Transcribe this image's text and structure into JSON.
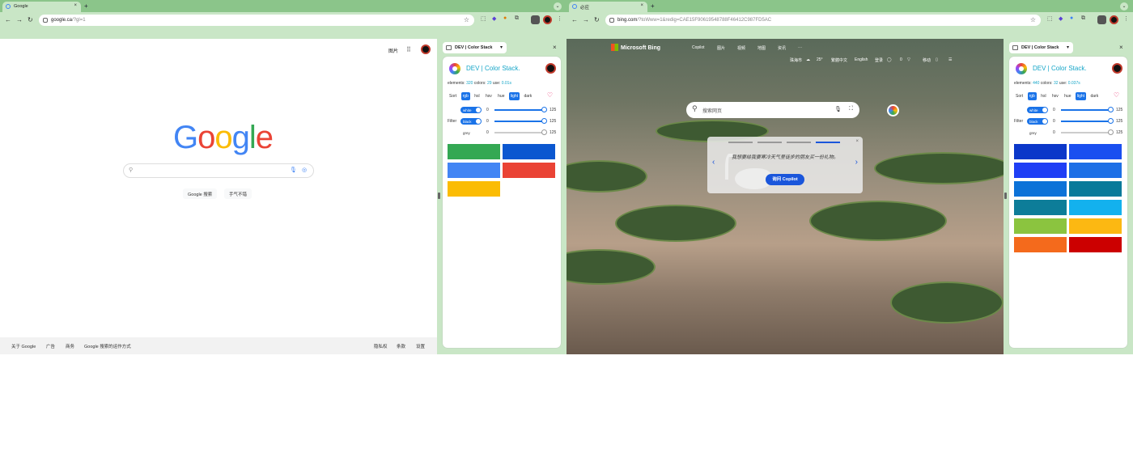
{
  "left": {
    "tab_title": "Google",
    "url_host": "google.ca",
    "url_path": "/?gl=1",
    "google": {
      "logo_g1": "G",
      "logo_o1": "o",
      "logo_o2": "o",
      "logo_g2": "g",
      "logo_l": "l",
      "logo_e": "e",
      "top_images": "图片",
      "search_button": "Google 搜索",
      "lucky_button": "手气不错",
      "footer": {
        "about": "关于 Google",
        "ads": "广告",
        "business": "商务",
        "how_search": "Google 搜索的运作方式",
        "privacy": "隐私权",
        "terms": "条款",
        "settings": "设置"
      }
    },
    "panel": {
      "header": "DEV | Color Stack",
      "title": "DEV | Color Stack.",
      "elements_label": "elements:",
      "elements_value": "320",
      "colors_label": "colors:",
      "colors_value": "29",
      "use_label": "use:",
      "use_value": "0.01s",
      "swatches": [
        "#34a853",
        "#0b57d0",
        "#4285f4",
        "#ea4335",
        "#fbbc04"
      ]
    }
  },
  "right": {
    "tab_title": "必应",
    "url_host": "bing.com",
    "url_path": "/?toWww=1&redig=CAE15F90619548788F46412C987FD5AC",
    "bing": {
      "logo": "Microsoft Bing",
      "nav": [
        "Copilot",
        "图片",
        "视频",
        "地图",
        "资讯",
        "···"
      ],
      "location": "珠海市",
      "temp": "25°",
      "lang_cn": "繁體中文",
      "lang_en": "English",
      "login": "登录",
      "points": "0",
      "mobile": "移动",
      "search_placeholder": "搜索网页",
      "card_question": "我想要给我要寒冷天气里徒步的朋友买一份礼物。",
      "card_button": "询问 Copilot"
    },
    "panel": {
      "header": "DEV | Color Stack",
      "title": "DEV | Color Stack.",
      "elements_label": "elements:",
      "elements_value": "440",
      "colors_label": "colors:",
      "colors_value": "32",
      "use_label": "use:",
      "use_value": "0.037s",
      "swatches": [
        "#0b37c9",
        "#1a4ff0",
        "#1f3ef5",
        "#1d6fe6",
        "#0c72d8",
        "#087a9a",
        "#0d7d99",
        "#13b1ee",
        "#8bc43f",
        "#fcb812",
        "#f46a1c",
        "#cc0000"
      ]
    }
  },
  "common": {
    "sort_label": "Sort",
    "sort_options": [
      "rgb",
      "hsl",
      "hsv",
      "hue",
      "light",
      "dark"
    ],
    "filter_label": "Filter",
    "filter_white": "white",
    "filter_black": "black",
    "filter_grey": "grey",
    "range_min": "0",
    "range_max": "125"
  }
}
